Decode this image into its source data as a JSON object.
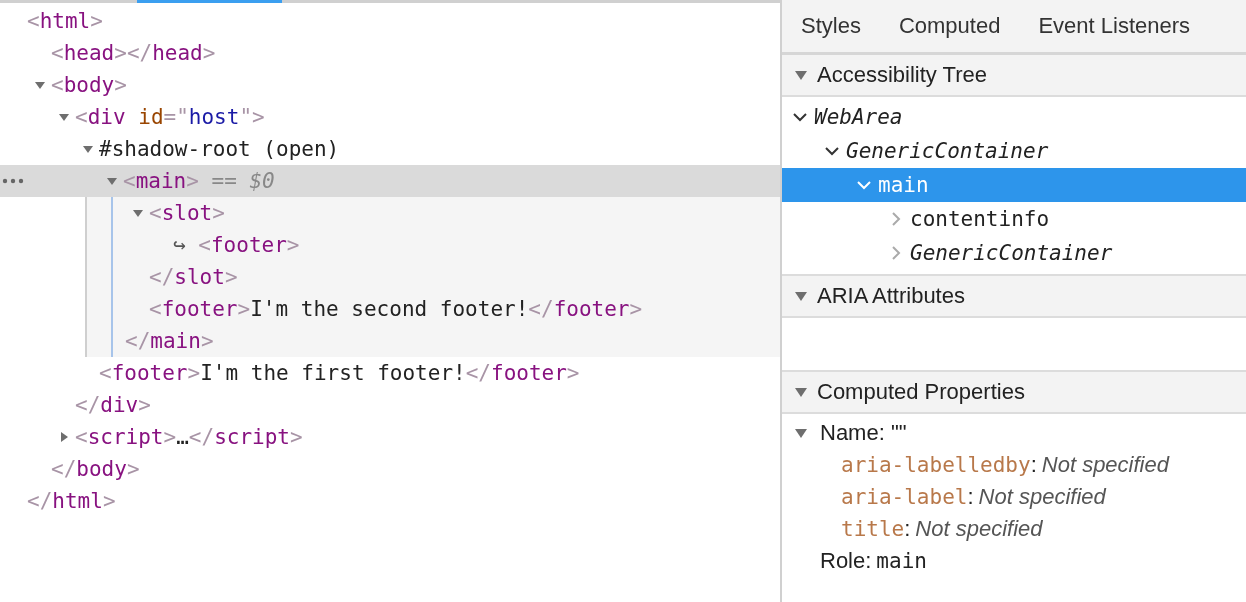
{
  "dom_tree": {
    "selected": false,
    "tokens": [
      {
        "kind": "bracket",
        "text": "<"
      },
      {
        "kind": "tag",
        "text": "html"
      },
      {
        "kind": "bracket",
        "text": ">"
      }
    ],
    "close": [
      {
        "kind": "bracket",
        "text": "</"
      },
      {
        "kind": "tag",
        "text": "html"
      },
      {
        "kind": "bracket",
        "text": ">"
      }
    ],
    "children": [
      {
        "selected": false,
        "tokens": [
          {
            "kind": "bracket",
            "text": "<"
          },
          {
            "kind": "tag",
            "text": "head"
          },
          {
            "kind": "bracket",
            "text": "></"
          },
          {
            "kind": "tag",
            "text": "head"
          },
          {
            "kind": "bracket",
            "text": ">"
          }
        ]
      },
      {
        "selected": false,
        "expanded": true,
        "tokens": [
          {
            "kind": "bracket",
            "text": "<"
          },
          {
            "kind": "tag",
            "text": "body"
          },
          {
            "kind": "bracket",
            "text": ">"
          }
        ],
        "close": [
          {
            "kind": "bracket",
            "text": "</"
          },
          {
            "kind": "tag",
            "text": "body"
          },
          {
            "kind": "bracket",
            "text": ">"
          }
        ],
        "children": [
          {
            "selected": false,
            "expanded": true,
            "tokens": [
              {
                "kind": "bracket",
                "text": "<"
              },
              {
                "kind": "tag",
                "text": "div "
              },
              {
                "kind": "attr",
                "text": "id"
              },
              {
                "kind": "bracket",
                "text": "=\""
              },
              {
                "kind": "value",
                "text": "host"
              },
              {
                "kind": "bracket",
                "text": "\">"
              }
            ],
            "close": [
              {
                "kind": "bracket",
                "text": "</"
              },
              {
                "kind": "tag",
                "text": "div"
              },
              {
                "kind": "bracket",
                "text": ">"
              }
            ],
            "children": [
              {
                "selected": false,
                "expanded": true,
                "tokens": [
                  {
                    "kind": "text",
                    "text": "#shadow-root (open)"
                  }
                ],
                "children": [
                  {
                    "selected": true,
                    "expanded": true,
                    "tokens": [
                      {
                        "kind": "bracket",
                        "text": "<"
                      },
                      {
                        "kind": "tag",
                        "text": "main"
                      },
                      {
                        "kind": "bracket",
                        "text": ">"
                      },
                      {
                        "kind": "marker",
                        "text": " == $0"
                      }
                    ],
                    "close": [
                      {
                        "kind": "bracket",
                        "text": "</"
                      },
                      {
                        "kind": "tag",
                        "text": "main"
                      },
                      {
                        "kind": "bracket",
                        "text": ">"
                      }
                    ],
                    "children": [
                      {
                        "selected": false,
                        "expanded": true,
                        "tokens": [
                          {
                            "kind": "bracket",
                            "text": "<"
                          },
                          {
                            "kind": "tag",
                            "text": "slot"
                          },
                          {
                            "kind": "bracket",
                            "text": ">"
                          }
                        ],
                        "close": [
                          {
                            "kind": "bracket",
                            "text": "</"
                          },
                          {
                            "kind": "tag",
                            "text": "slot"
                          },
                          {
                            "kind": "bracket",
                            "text": ">"
                          }
                        ],
                        "children": [
                          {
                            "selected": false,
                            "tokens": [
                              {
                                "kind": "ref",
                                "text": "↪ "
                              },
                              {
                                "kind": "bracket",
                                "text": "<"
                              },
                              {
                                "kind": "tag",
                                "text": "footer"
                              },
                              {
                                "kind": "bracket",
                                "text": ">"
                              }
                            ]
                          }
                        ]
                      },
                      {
                        "selected": false,
                        "tokens": [
                          {
                            "kind": "bracket",
                            "text": "<"
                          },
                          {
                            "kind": "tag",
                            "text": "footer"
                          },
                          {
                            "kind": "bracket",
                            "text": ">"
                          },
                          {
                            "kind": "text",
                            "text": "I'm the second footer!"
                          },
                          {
                            "kind": "bracket",
                            "text": "</"
                          },
                          {
                            "kind": "tag",
                            "text": "footer"
                          },
                          {
                            "kind": "bracket",
                            "text": ">"
                          }
                        ]
                      }
                    ]
                  }
                ]
              },
              {
                "selected": false,
                "tokens": [
                  {
                    "kind": "bracket",
                    "text": "<"
                  },
                  {
                    "kind": "tag",
                    "text": "footer"
                  },
                  {
                    "kind": "bracket",
                    "text": ">"
                  },
                  {
                    "kind": "text",
                    "text": "I'm the first footer!"
                  },
                  {
                    "kind": "bracket",
                    "text": "</"
                  },
                  {
                    "kind": "tag",
                    "text": "footer"
                  },
                  {
                    "kind": "bracket",
                    "text": ">"
                  }
                ]
              }
            ]
          },
          {
            "selected": false,
            "expanded": false,
            "tokens": [
              {
                "kind": "bracket",
                "text": "<"
              },
              {
                "kind": "tag",
                "text": "script"
              },
              {
                "kind": "bracket",
                "text": ">"
              },
              {
                "kind": "text",
                "text": "…"
              },
              {
                "kind": "bracket",
                "text": "</"
              },
              {
                "kind": "tag",
                "text": "script"
              },
              {
                "kind": "bracket",
                "text": ">"
              }
            ]
          }
        ]
      }
    ]
  },
  "sidebar": {
    "tabs": [
      {
        "label": "Styles",
        "selected": false
      },
      {
        "label": "Computed",
        "selected": false
      },
      {
        "label": "Event Listeners",
        "selected": false
      }
    ],
    "accessibility_tree": {
      "title": "Accessibility Tree",
      "expanded": true,
      "nodes": [
        {
          "name": "WebArea",
          "kind": "generic",
          "expanded": true,
          "selected": false,
          "children": [
            {
              "name": "GenericContainer",
              "kind": "generic",
              "expanded": true,
              "selected": false,
              "children": [
                {
                  "name": "main",
                  "kind": "role",
                  "expanded": true,
                  "selected": true,
                  "children": [
                    {
                      "name": "contentinfo",
                      "kind": "role",
                      "expanded": false,
                      "selected": false
                    },
                    {
                      "name": "GenericContainer",
                      "kind": "generic",
                      "expanded": false,
                      "selected": false
                    }
                  ]
                }
              ]
            }
          ]
        }
      ]
    },
    "aria_attributes": {
      "title": "ARIA Attributes",
      "expanded": true
    },
    "computed_properties": {
      "title": "Computed Properties",
      "expanded": true,
      "name_label": "Name:",
      "name_value": "\"\"",
      "name_expanded": true,
      "properties": [
        {
          "name": "aria-labelledby",
          "separator": ":",
          "value": "Not specified"
        },
        {
          "name": "aria-label",
          "separator": ":",
          "value": "Not specified"
        },
        {
          "name": "title",
          "separator": ":",
          "value": "Not specified"
        }
      ],
      "role_label": "Role:",
      "role_value": "main"
    }
  }
}
